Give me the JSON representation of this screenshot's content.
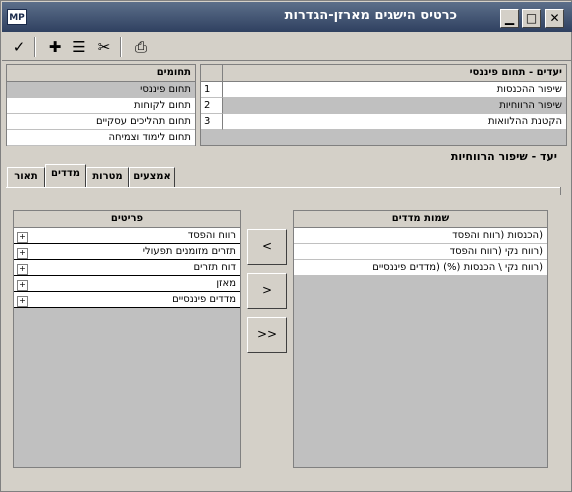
{
  "window": {
    "title": "כרטיס הישגים מארזן-הגדרות",
    "logo": "MP"
  },
  "toolbar": {
    "icons": [
      "check-icon",
      "plus-icon",
      "list-icon",
      "scissors-icon",
      "printer-icon"
    ],
    "glyphs": [
      "✓",
      "✚",
      "☰",
      "✂",
      "⎙"
    ]
  },
  "goals": {
    "header": "יעדים - תחום פיננסי",
    "rows": [
      {
        "num": "1",
        "label": "שיפור ההכנסות"
      },
      {
        "num": "2",
        "label": "שיפור הרווחיות"
      },
      {
        "num": "3",
        "label": "הקטנת ההלוואות"
      }
    ]
  },
  "domains": {
    "header": "תחומים",
    "items": [
      "תחום פיננסי",
      "תחום לקוחות",
      "תחום תהליכים עסקיים",
      "תחום לימוד וצמיחה"
    ]
  },
  "goal_title": "יעד - שיפור הרווחיות",
  "tabs": [
    "אמצעים",
    "מטרות",
    "מדדים",
    "תאור"
  ],
  "measures": {
    "header": "שמות מדדים",
    "items": [
      "(הכנסות (רווח והפסד",
      "(רווח נקי (רווח והפסד",
      "(רווח נקי \\ הכנסות (%) (מדדים פיננסיים"
    ]
  },
  "items_panel": {
    "header": "פריטים",
    "items": [
      "רווח והפסד",
      "תזרים מזומנים תפעולי",
      "דוח תזרים",
      "מאזן",
      "מדדים פיננסיים"
    ]
  },
  "buttons": {
    "add": "<",
    "remove": ">",
    "remove_all": ">>"
  }
}
